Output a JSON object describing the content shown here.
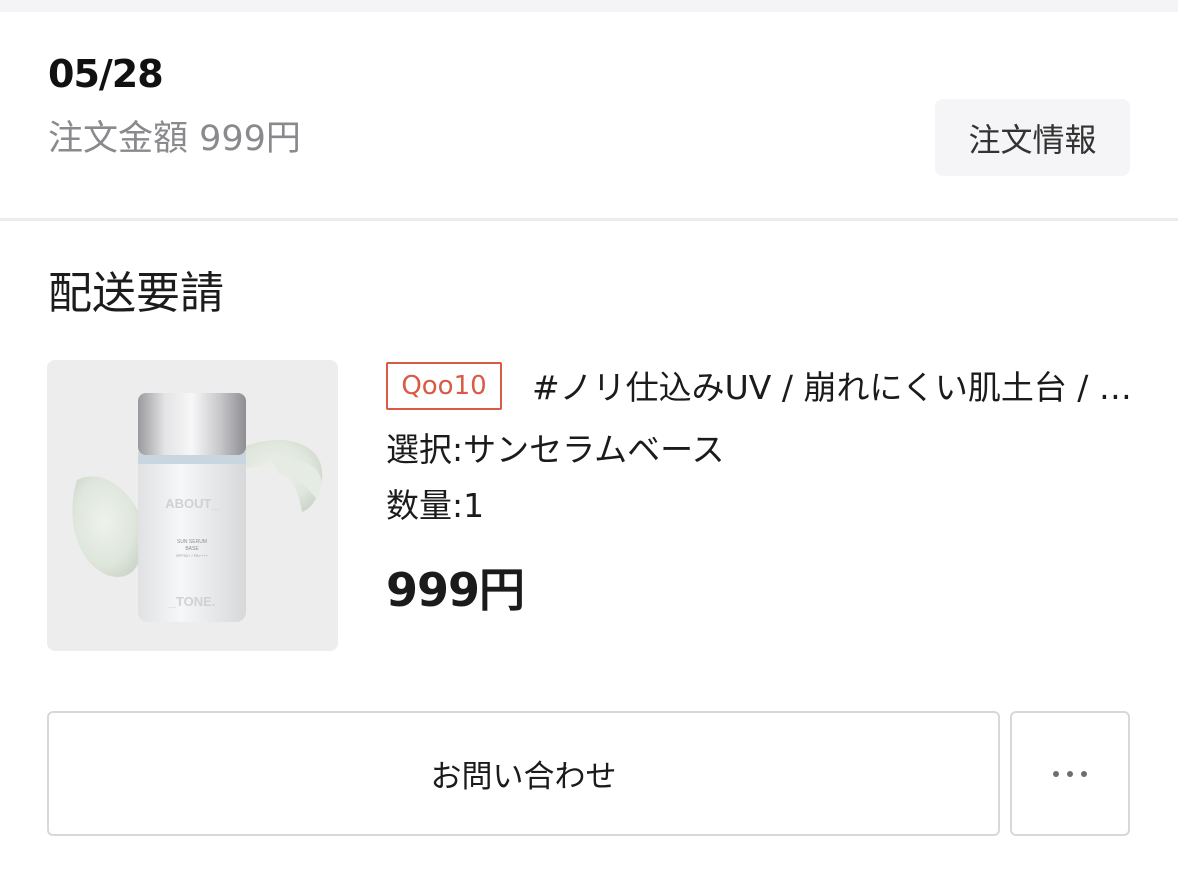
{
  "order": {
    "date": "05/28",
    "amount_text": "注文金額 999円",
    "info_button_label": "注文情報"
  },
  "section": {
    "title": "配送要請"
  },
  "product": {
    "mall_badge": "Qoo10",
    "name": "#ノリ仕込みUV / 崩れにくい肌土台 / 化粧持ち / トーンアップ / 日焼け止め下地",
    "option_text": "選択:サンセラムベース",
    "quantity_text": "数量:1",
    "price_text": "999円",
    "image_text": {
      "brand_top": "ABOUT_",
      "line1": "SUN SERUM",
      "line2": "BASE",
      "line3": "SPF50+ / PA++++",
      "brand_bottom": "_TONE."
    }
  },
  "actions": {
    "inquiry_label": "お問い合わせ",
    "more_icon": "ellipsis-icon"
  },
  "colors": {
    "badge": "#d95a45",
    "background_band": "#f4f4f6",
    "muted_text": "#8a8a8e"
  }
}
